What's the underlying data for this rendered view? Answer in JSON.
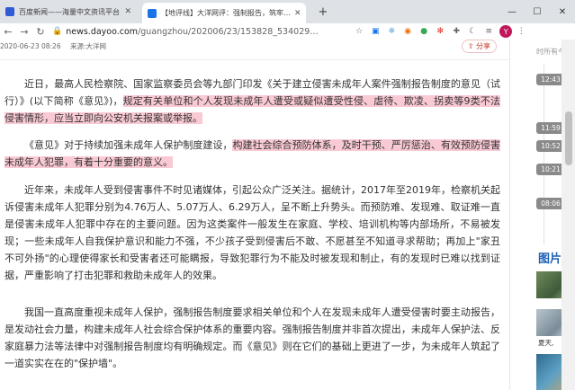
{
  "browser": {
    "tabs": [
      {
        "title": "百度新闻——海量中文资讯平台",
        "favicon_color": "#2f5cd6"
      },
      {
        "title": "【地评线】大洋网评：强制报告，筑牢…",
        "favicon_color": "#1a73e8"
      }
    ],
    "new_tab_label": "+",
    "window_controls": {
      "minimize": "—",
      "maximize": "☐",
      "close": "✕"
    },
    "url_host": "news.dayoo.com",
    "url_path": "/guangzhou/202006/23/153828_534029…",
    "avatar_letter": "Y"
  },
  "article": {
    "date": "2020-06-23 08:26",
    "source": "来源:大洋网",
    "share_label": "分享",
    "paragraphs": [
      {
        "before": "近日，最高人民检察院、国家监察委员会等九部门印发《关于建立侵害未成年人案件强制报告制度的意见（试行）》(以下简称《意见》)，",
        "highlight": "规定有关单位和个人发现未成年人遭受或疑似遭受性侵、虐待、欺凌、拐卖等9类不法侵害情形，应当立即向公安机关报案或举报。",
        "after": ""
      },
      {
        "before": "《意见》对于持续加强未成年人保护制度建设，",
        "highlight": "构建社会综合预防体系，及时干预、严厉惩治、有效预防侵害未成年人犯罪，有着十分重要的意义。",
        "after": ""
      },
      {
        "before": "近年来，未成年人受到侵害事件不时见诸媒体，引起公众广泛关注。据统计，2017年至2019年，检察机关起诉侵害未成年人犯罪分别为4.76万人、5.07万人、6.29万人，呈不断上升势头。而预防难、发现难、取证难一直是侵害未成年人犯罪中存在的主要问题。因为这类案件一般发生在家庭、学校、培训机构等内部场所，不易被发现；一些未成年人自我保护意识和能力不强，不少孩子受到侵害后不敢、不愿甚至不知道寻求帮助；再加上\"家丑不可外扬\"的心理使得家长和受害者还可能瞒报，导致犯罪行为不能及时被发现和制止，有的发现时已难以找到证据，严重影响了打击犯罪和救助未成年人的效果。",
        "highlight": "",
        "after": ""
      },
      {
        "before": "我国一直高度重视未成年人保护，强制报告制度要求相关单位和个人在发现未成年人遭受侵害时要主动报告，是发动社会力量，构建未成年人社会综合保护体系的重要内容。强制报告制度并非首次提出，未成年人保护法、反家庭暴力法等法律中对强制报告制度均有明确规定。而《意见》则在它们的基础上更进了一步，为未成年人筑起了一道实实在在的\"保护墙\"。",
        "highlight": "",
        "after": ""
      }
    ]
  },
  "sidebar": {
    "title": "时所有今",
    "times": [
      "12:43",
      "11:59",
      "10:52",
      "10:21",
      "08:06"
    ],
    "heading": "图片",
    "caption": "夏天,"
  }
}
